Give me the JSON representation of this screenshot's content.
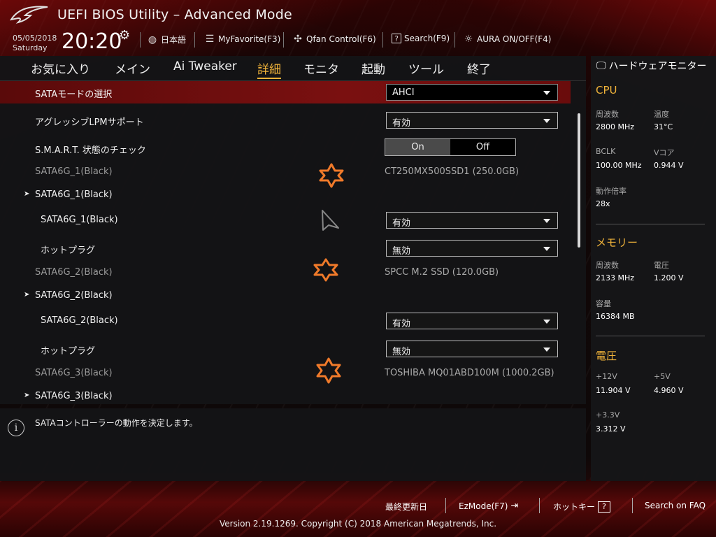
{
  "header": {
    "title": "UEFI BIOS Utility – Advanced Mode",
    "date": "05/05/2018",
    "day": "Saturday",
    "time": "20:20",
    "items": {
      "language": "日本語",
      "favorite": "MyFavorite(F3)",
      "qfan": "Qfan Control(F6)",
      "search": "Search(F9)",
      "aura": "AURA ON/OFF(F4)"
    }
  },
  "tabs": [
    "お気に入り",
    "メイン",
    "Ai Tweaker",
    "詳細",
    "モニタ",
    "起動",
    "ツール",
    "終了"
  ],
  "active_tab": "詳細",
  "settings": {
    "sata_mode": {
      "label": "SATAモードの選択",
      "value": "AHCI"
    },
    "lpm": {
      "label": "アグレッシブLPMサポート",
      "value": "有効"
    },
    "smart": {
      "label": "S.M.A.R.T. 状態のチェック",
      "on": "On",
      "off": "Off",
      "selected": "On"
    },
    "port1_info": {
      "label": "SATA6G_1(Black)",
      "value": "CT250MX500SSD1 (250.0GB)"
    },
    "port1_group": {
      "label": "SATA6G_1(Black)"
    },
    "port1_enable": {
      "label": "SATA6G_1(Black)",
      "value": "有効"
    },
    "port1_hotplug": {
      "label": "ホットプラグ",
      "value": "無効"
    },
    "port2_info": {
      "label": "SATA6G_2(Black)",
      "value": "SPCC M.2 SSD (120.0GB)"
    },
    "port2_group": {
      "label": "SATA6G_2(Black)"
    },
    "port2_enable": {
      "label": "SATA6G_2(Black)",
      "value": "有効"
    },
    "port2_hotplug": {
      "label": "ホットプラグ",
      "value": "無効"
    },
    "port3_info": {
      "label": "SATA6G_3(Black)",
      "value": "TOSHIBA MQ01ABD100M (1000.2GB)"
    },
    "port3_group": {
      "label": "SATA6G_3(Black)"
    }
  },
  "info": {
    "text": "SATAコントローラーの動作を決定します。"
  },
  "monitor": {
    "title": "ハードウェアモニター",
    "cpu": {
      "heading": "CPU",
      "freq_label": "周波数",
      "freq": "2800 MHz",
      "temp_label": "温度",
      "temp": "31°C",
      "bclk_label": "BCLK",
      "bclk": "100.00 MHz",
      "vcore_label": "Vコア",
      "vcore": "0.944 V",
      "ratio_label": "動作倍率",
      "ratio": "28x"
    },
    "memory": {
      "heading": "メモリー",
      "freq_label": "周波数",
      "freq": "2133 MHz",
      "volt_label": "電圧",
      "volt": "1.200 V",
      "cap_label": "容量",
      "cap": "16384 MB"
    },
    "voltage": {
      "heading": "電圧",
      "v12_label": "+12V",
      "v12": "11.904 V",
      "v5_label": "+5V",
      "v5": "4.960 V",
      "v33_label": "+3.3V",
      "v33": "3.312 V"
    }
  },
  "footer": {
    "last_modified": "最終更新日",
    "ezmode": "EzMode(F7)",
    "hotkeys": "ホットキー",
    "hotkeys_icon": "?",
    "faq": "Search on FAQ",
    "copyright": "Version 2.19.1269. Copyright (C) 2018 American Megatrends, Inc."
  },
  "colors": {
    "accent": "#f0b33a",
    "selected_row": "#6a0c0c",
    "star": "#f07a2a"
  }
}
